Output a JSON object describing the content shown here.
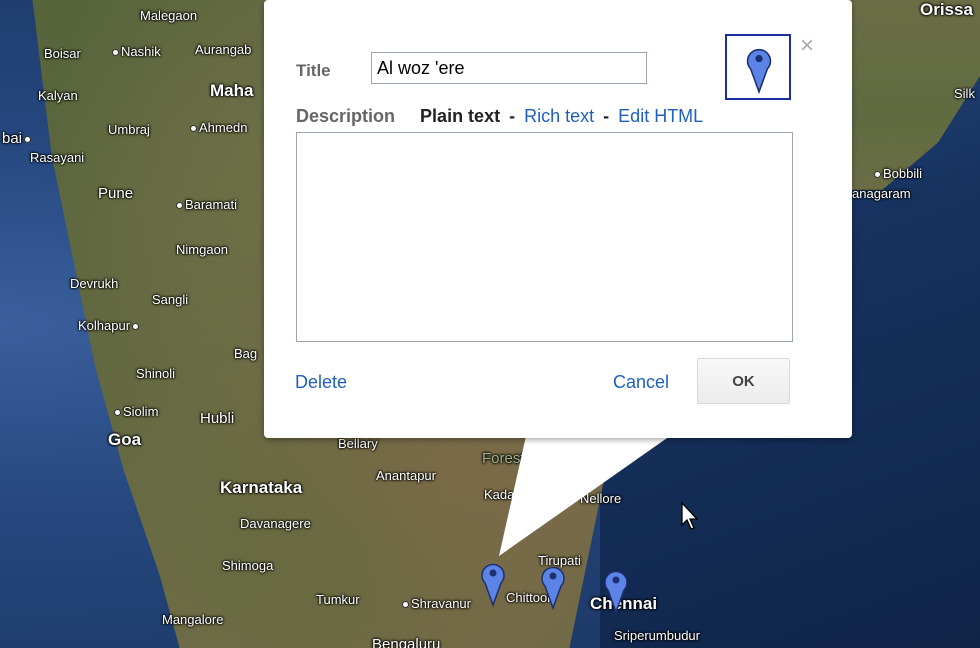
{
  "map": {
    "cities": [
      {
        "label": "Malegaon"
      },
      {
        "label": "Boisar"
      },
      {
        "label": "Nashik"
      },
      {
        "label": "Aurangab"
      },
      {
        "label": "Maha"
      },
      {
        "label": "Kalyan"
      },
      {
        "label": "Umbraj"
      },
      {
        "label": "Ahmedn"
      },
      {
        "label": "bai"
      },
      {
        "label": "Rasayani"
      },
      {
        "label": "Pune"
      },
      {
        "label": "Baramati"
      },
      {
        "label": "Nimgaon"
      },
      {
        "label": "Devrukh"
      },
      {
        "label": "Sangli"
      },
      {
        "label": "Kolhapur"
      },
      {
        "label": "Bag"
      },
      {
        "label": "Shinoli"
      },
      {
        "label": "Siolim"
      },
      {
        "label": "Hubli"
      },
      {
        "label": "Goa"
      },
      {
        "label": "Bellary"
      },
      {
        "label": "Anantapur"
      },
      {
        "label": "Karnataka"
      },
      {
        "label": "Davanagere"
      },
      {
        "label": "Shimoga"
      },
      {
        "label": "Tumkur"
      },
      {
        "label": "Shravanur"
      },
      {
        "label": "Mangalore"
      },
      {
        "label": "Forest"
      },
      {
        "label": "Kadapa"
      },
      {
        "label": "Nellore"
      },
      {
        "label": "Tirupati"
      },
      {
        "label": "Chittoor"
      },
      {
        "label": "Chennai"
      },
      {
        "label": "Sriperumbudur"
      },
      {
        "label": "Bengaluru"
      },
      {
        "label": "Orissa"
      },
      {
        "label": "Silk"
      },
      {
        "label": "Bobbili"
      },
      {
        "label": "anagaram"
      }
    ],
    "pin_color": "#5b84e6"
  },
  "dialog": {
    "title_label": "Title",
    "title_value": "Al woz 'ere",
    "description_label": "Description",
    "mode_plain": "Plain text",
    "separator": "-",
    "mode_rich": "Rich text",
    "mode_html": "Edit HTML",
    "description_value": "",
    "delete_label": "Delete",
    "cancel_label": "Cancel",
    "ok_label": "OK",
    "close_glyph": "×"
  }
}
